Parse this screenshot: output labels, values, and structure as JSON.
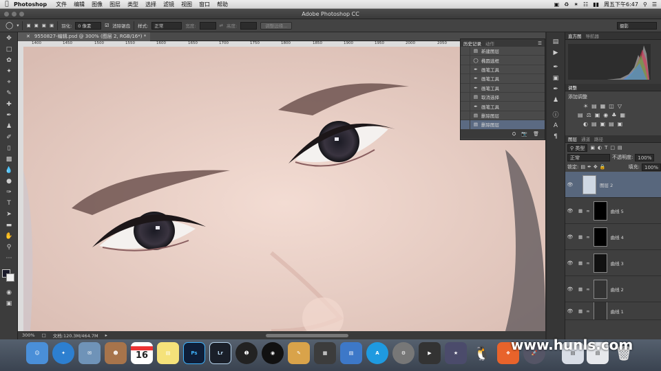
{
  "menubar": {
    "app": "Photoshop",
    "items": [
      "文件",
      "编辑",
      "图像",
      "图层",
      "类型",
      "选择",
      "滤镜",
      "视图",
      "窗口",
      "帮助"
    ],
    "clock": "周五下午6:47"
  },
  "window": {
    "title": "Adobe Photoshop CC"
  },
  "options": {
    "feather_label": "羽化:",
    "feather_value": "0 像素",
    "antialias_label": "消除锯齿",
    "style_label": "样式:",
    "style_value": "正常",
    "width_label": "宽度:",
    "height_label": "高度:",
    "refine_button": "调整边缘...",
    "workspace": "摄影"
  },
  "document": {
    "tab_title": "9550827-编辑.psd @ 300% (图层 2, RGB/16*) *",
    "zoom": "300%",
    "doc_info": "文档:120.3M/464.7M"
  },
  "ruler_ticks": [
    "1400",
    "1450",
    "1500",
    "1550",
    "1600",
    "1650",
    "1700",
    "1750",
    "1800",
    "1850",
    "1900",
    "1950",
    "2000",
    "2050"
  ],
  "history_panel": {
    "tabs": [
      "历史记录",
      "动作"
    ],
    "items": [
      {
        "icon": "doc",
        "label": "新建图层"
      },
      {
        "icon": "ellipse",
        "label": "椭圆选框"
      },
      {
        "icon": "brush",
        "label": "画笔工具"
      },
      {
        "icon": "brush",
        "label": "画笔工具"
      },
      {
        "icon": "brush",
        "label": "画笔工具"
      },
      {
        "icon": "doc",
        "label": "取消选择"
      },
      {
        "icon": "brush",
        "label": "画笔工具"
      },
      {
        "icon": "doc",
        "label": "删除图层"
      },
      {
        "icon": "doc",
        "label": "删除图层"
      }
    ],
    "selected_index": 8
  },
  "panels": {
    "histogram_tabs": [
      "直方图",
      "导航器"
    ],
    "adjust_tab": "调整",
    "adjust_title": "添加调整",
    "layer_tabs": [
      "图层",
      "通道",
      "路径"
    ],
    "kind_filter": "类型",
    "blend_mode": "正常",
    "opacity_label": "不透明度:",
    "opacity_value": "100%",
    "lock_label": "锁定:",
    "fill_label": "填充:",
    "fill_value": "100%",
    "layers": [
      {
        "name": "图层 2",
        "selected": true
      },
      {
        "name": "曲线 5",
        "selected": false
      },
      {
        "name": "曲线 4",
        "selected": false
      },
      {
        "name": "曲线 3",
        "selected": false
      },
      {
        "name": "曲线 2",
        "selected": false
      },
      {
        "name": "曲线 1",
        "selected": false
      }
    ]
  },
  "watermark": "www.hunls.com",
  "dock": {
    "calendar_day": "16",
    "ps_label": "Ps",
    "lr_label": "Lr"
  },
  "colors": {
    "accent_selected": "#5b6a82",
    "panel_bg": "#3f3f3f"
  }
}
